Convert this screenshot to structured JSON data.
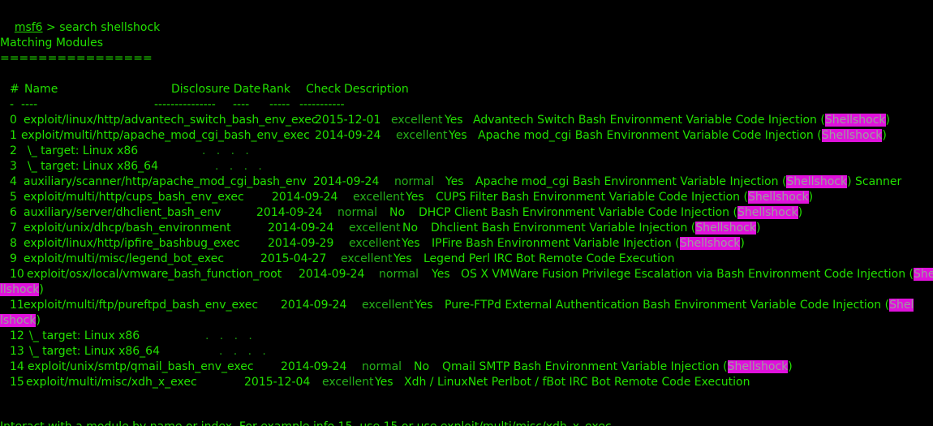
{
  "prompt": {
    "name": "msf6",
    "separator": " > ",
    "command": "search shellshock"
  },
  "section": {
    "title": "Matching Modules",
    "underline": "================"
  },
  "table": {
    "headers": {
      "num": "#",
      "name": "Name",
      "date": "Disclosure Date",
      "rank": "Rank",
      "check": "Check",
      "description": "Description"
    },
    "dashes": {
      "num": "-",
      "name": "----",
      "date": "---------------",
      "rank": "----",
      "check": "-----",
      "description": "-----------"
    },
    "rows": [
      {
        "num": "0",
        "name": "exploit/linux/http/advantech_switch_bash_env_exec",
        "date": "2015-12-01",
        "rank": "excellent",
        "check": "Yes",
        "desc_pre": "Advantech Switch Bash Environment Variable Code Injection (",
        "desc_hl": "Shellshock",
        "desc_post": ")"
      },
      {
        "num": "1",
        "name": "exploit/multi/http/apache_mod_cgi_bash_env_exec",
        "date": "2014-09-24",
        "rank": "excellent",
        "check": "Yes",
        "desc_pre": "Apache mod_cgi Bash Environment Variable Code Injection (",
        "desc_hl": "Shellshock",
        "desc_post": ")"
      },
      {
        "num": "2",
        "name": "\\_ target: Linux x86",
        "dots": ".   .   .   ."
      },
      {
        "num": "3",
        "name": "\\_ target: Linux x86_64",
        "dots": ".   .   .   ."
      },
      {
        "num": "4",
        "name": "auxiliary/scanner/http/apache_mod_cgi_bash_env",
        "date": "2014-09-24",
        "rank": "normal",
        "check": "Yes",
        "desc_pre": "Apache mod_cgi Bash Environment Variable Injection (",
        "desc_hl": "Shellshock",
        "desc_post": ") Scanner"
      },
      {
        "num": "5",
        "name": "exploit/multi/http/cups_bash_env_exec",
        "date": "2014-09-24",
        "rank": "excellent",
        "check": "Yes",
        "desc_pre": "CUPS Filter Bash Environment Variable Code Injection (",
        "desc_hl": "Shellshock",
        "desc_post": ")"
      },
      {
        "num": "6",
        "name": "auxiliary/server/dhclient_bash_env",
        "date": "2014-09-24",
        "rank": "normal",
        "check": "No",
        "desc_pre": "DHCP Client Bash Environment Variable Code Injection (",
        "desc_hl": "Shellshock",
        "desc_post": ")"
      },
      {
        "num": "7",
        "name": "exploit/unix/dhcp/bash_environment",
        "date": "2014-09-24",
        "rank": "excellent",
        "check": "No",
        "desc_pre": "Dhclient Bash Environment Variable Injection (",
        "desc_hl": "Shellshock",
        "desc_post": ")"
      },
      {
        "num": "8",
        "name": "exploit/linux/http/ipfire_bashbug_exec",
        "date": "2014-09-29",
        "rank": "excellent",
        "check": "Yes",
        "desc_pre": "IPFire Bash Environment Variable Injection (",
        "desc_hl": "Shellshock",
        "desc_post": ")"
      },
      {
        "num": "9",
        "name": "exploit/multi/misc/legend_bot_exec",
        "date": "2015-04-27",
        "rank": "excellent",
        "check": "Yes",
        "desc_pre": "Legend Perl IRC Bot Remote Code Execution",
        "desc_hl": "",
        "desc_post": ""
      },
      {
        "num": "10",
        "name": "exploit/osx/local/vmware_bash_function_root",
        "date": "2014-09-24",
        "rank": "normal",
        "check": "Yes",
        "desc_pre": "OS X VMWare Fusion Privilege Escalation via Bash Environment Code Injection (",
        "desc_hl": "She",
        "desc_post": "",
        "wrap_hl": "llshock",
        "wrap_post": ")"
      },
      {
        "num": "11",
        "name": "exploit/multi/ftp/pureftpd_bash_env_exec",
        "date": "2014-09-24",
        "rank": "excellent",
        "check": "Yes",
        "desc_pre": "Pure-FTPd External Authentication Bash Environment Variable Code Injection (",
        "desc_hl": "Shel",
        "desc_post": "",
        "wrap_hl": "lshock",
        "wrap_post": ")"
      },
      {
        "num": "12",
        "name": "\\_ target: Linux x86",
        "dots": ".   .   .   ."
      },
      {
        "num": "13",
        "name": "\\_ target: Linux x86_64",
        "dots": ".   .   .   ."
      },
      {
        "num": "14",
        "name": "exploit/unix/smtp/qmail_bash_env_exec",
        "date": "2014-09-24",
        "rank": "normal",
        "check": "No",
        "desc_pre": "Qmail SMTP Bash Environment Variable Injection (",
        "desc_hl": "Shellshock",
        "desc_post": ")"
      },
      {
        "num": "15",
        "name": "exploit/multi/misc/xdh_x_exec",
        "date": "2015-12-04",
        "rank": "excellent",
        "check": "Yes",
        "desc_pre": "Xdh / LinuxNet Perlbot / fBot IRC Bot Remote Code Execution",
        "desc_hl": "",
        "desc_post": ""
      }
    ]
  },
  "footer_partial": "Interact with a module by name or index. For example info 15, use 15 or use exploit/multi/misc/xdh_x_exec",
  "colors": {
    "background": "#000000",
    "text": "#22e000",
    "highlight_bg": "#e011dc",
    "highlight_text": "#9d9d9d"
  }
}
